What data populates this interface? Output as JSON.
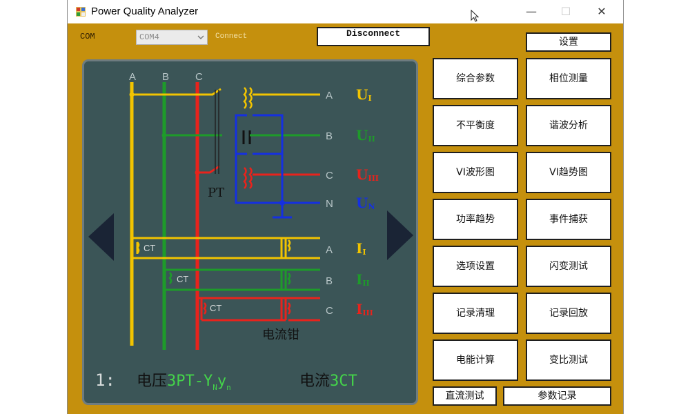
{
  "window": {
    "title": "Power Quality Analyzer",
    "minimize": "—",
    "maximize": "☐",
    "close": "✕"
  },
  "toolbar": {
    "com_label": "COM",
    "com_value": "COM4",
    "connect_label": "Connect",
    "disconnect_label": "Disconnect",
    "settings_label": "设置"
  },
  "menu": {
    "buttons": [
      "综合参数",
      "相位测量",
      "不平衡度",
      "谐波分析",
      "VI波形图",
      "VI趋势图",
      "功率趋势",
      "事件捕获",
      "选项设置",
      "闪变测试",
      "记录清理",
      "记录回放",
      "电能计算",
      "变比测试"
    ],
    "dc_test": "直流测试",
    "param_record": "参数记录"
  },
  "diagram": {
    "phases": [
      "A",
      "B",
      "C"
    ],
    "pt_label": "PT",
    "ct_label": "CT",
    "clamp_label": "电流钳",
    "volt_terminals": [
      "A",
      "B",
      "C",
      "N"
    ],
    "volt_labels": [
      {
        "main": "U",
        "sub": "I"
      },
      {
        "main": "U",
        "sub": "II"
      },
      {
        "main": "U",
        "sub": "III"
      },
      {
        "main": "U",
        "sub": "N"
      }
    ],
    "curr_terminals": [
      "A",
      "B",
      "C"
    ],
    "curr_labels": [
      {
        "main": "I",
        "sub": "I"
      },
      {
        "main": "I",
        "sub": "II"
      },
      {
        "main": "I",
        "sub": "III"
      }
    ],
    "caption": {
      "index": "1:",
      "volt_prefix": "电压",
      "volt_value": "3PT-Y",
      "volt_sub1": "N",
      "volt_mid": "y",
      "volt_sub2": "n",
      "curr_prefix": "电流",
      "curr_value": "3CT"
    },
    "colors": {
      "phase_a": "#f2c400",
      "phase_b": "#1e9b2a",
      "phase_c": "#e8231c",
      "neutral": "#1530e0",
      "panel": "#3b5557",
      "window": "#c5900d"
    }
  }
}
